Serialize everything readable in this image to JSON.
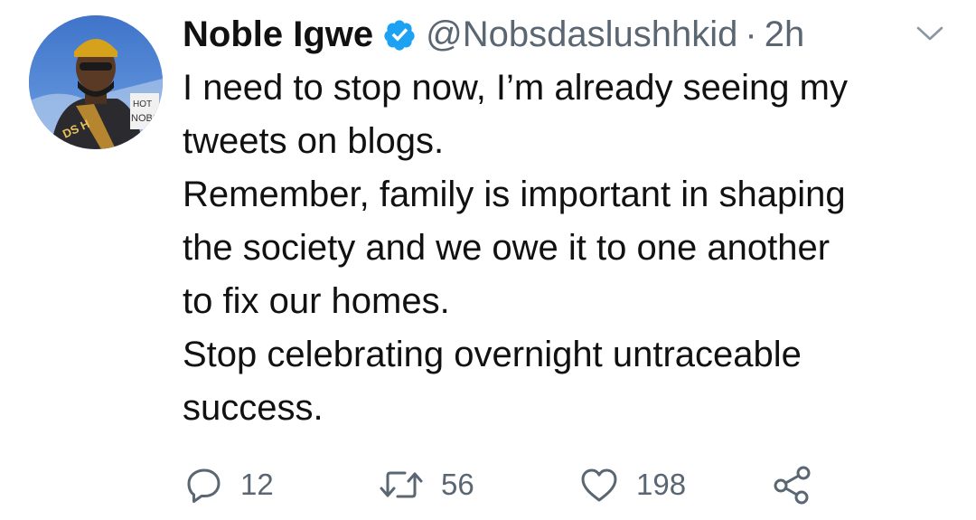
{
  "tweet": {
    "author": {
      "name": "Noble Igwe",
      "handle": "@Nobsdaslushhkid",
      "verified": true
    },
    "separator": "·",
    "time": "2h",
    "lines": [
      "I need to stop now, I’m already seeing my",
      "tweets on blogs.",
      "Remember, family is important in shaping",
      "the society and we owe it to one another",
      "to fix our homes.",
      "Stop celebrating overnight untraceable",
      "success."
    ],
    "actions": {
      "reply_count": "12",
      "retweet_count": "56",
      "like_count": "198"
    }
  },
  "icons": {
    "verified": "verified-badge-icon",
    "menu": "chevron-down-icon",
    "reply": "reply-icon",
    "retweet": "retweet-icon",
    "like": "heart-icon",
    "share": "share-icon"
  },
  "colors": {
    "verified_blue": "#1da1f2",
    "muted": "#5b6673",
    "text": "#111111",
    "background": "#ffffff"
  }
}
